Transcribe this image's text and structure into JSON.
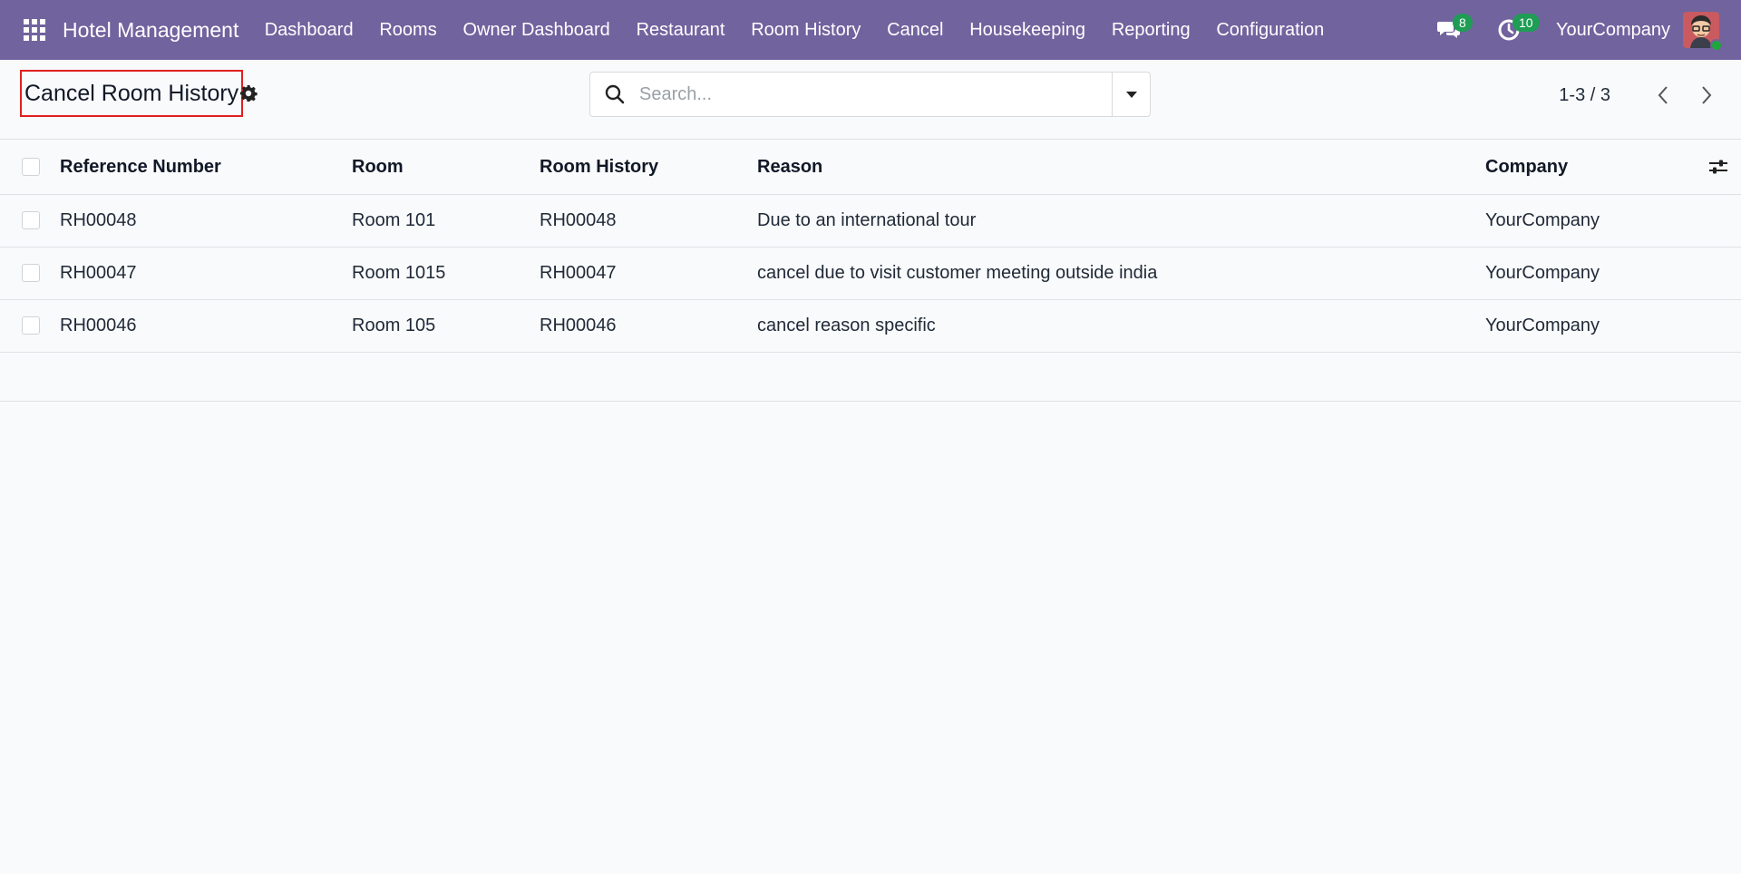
{
  "navbar": {
    "brand": "Hotel Management",
    "menu": [
      "Dashboard",
      "Rooms",
      "Owner Dashboard",
      "Restaurant",
      "Room History",
      "Cancel",
      "Housekeeping",
      "Reporting",
      "Configuration"
    ],
    "messages_count": "8",
    "activities_count": "10",
    "company": "YourCompany",
    "bg_color": "#71639e",
    "badge_color": "#1f9d55"
  },
  "control_panel": {
    "title": "Cancel Room History",
    "search_placeholder": "Search...",
    "pager": "1-3 / 3"
  },
  "table": {
    "columns": [
      "Reference Number",
      "Room",
      "Room History",
      "Reason",
      "Company"
    ],
    "rows": [
      {
        "ref": "RH00048",
        "room": "Room 101",
        "history": "RH00048",
        "reason": "Due to an international tour",
        "company": "YourCompany"
      },
      {
        "ref": "RH00047",
        "room": "Room 1015",
        "history": "RH00047",
        "reason": "cancel due to visit customer meeting outside india",
        "company": "YourCompany"
      },
      {
        "ref": "RH00046",
        "room": "Room 105",
        "history": "RH00046",
        "reason": "cancel reason specific",
        "company": "YourCompany"
      }
    ]
  }
}
